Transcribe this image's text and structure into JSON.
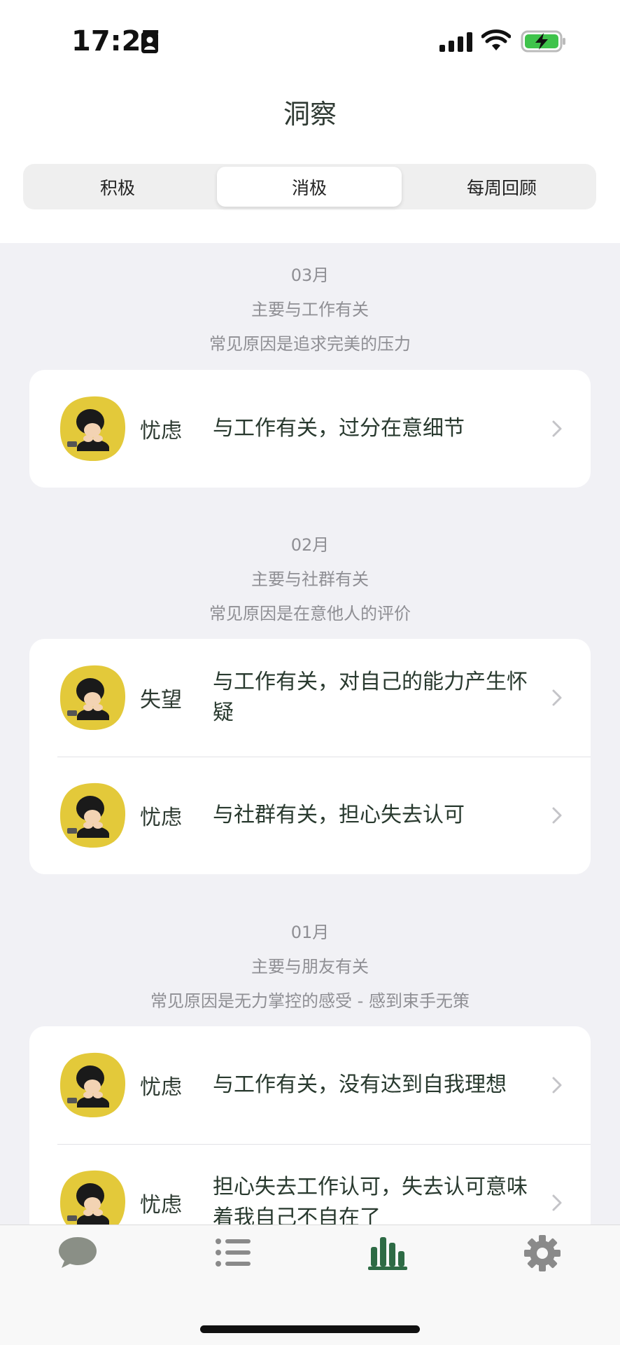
{
  "status": {
    "time": "17:27"
  },
  "header": {
    "title": "洞察"
  },
  "segments": [
    {
      "label": "积极",
      "active": false
    },
    {
      "label": "消极",
      "active": true
    },
    {
      "label": "每周回顾",
      "active": false
    }
  ],
  "months": [
    {
      "month": "03月",
      "summary": "主要与工作有关",
      "cause": "常见原因是追求完美的压力",
      "entries": [
        {
          "emotion": "忧虑",
          "reason": "与工作有关，过分在意细节"
        }
      ]
    },
    {
      "month": "02月",
      "summary": "主要与社群有关",
      "cause": "常见原因是在意他人的评价",
      "entries": [
        {
          "emotion": "失望",
          "reason": "与工作有关，对自己的能力产生怀疑"
        },
        {
          "emotion": "忧虑",
          "reason": "与社群有关，担心失去认可"
        }
      ]
    },
    {
      "month": "01月",
      "summary": "主要与朋友有关",
      "cause": "常见原因是无力掌控的感受 - 感到束手无策",
      "entries": [
        {
          "emotion": "忧虑",
          "reason": "与工作有关，没有达到自我理想"
        },
        {
          "emotion": "忧虑",
          "reason": "担心失去工作认可，失去认可意味着我自己不自在了"
        }
      ]
    }
  ],
  "tabbar": {
    "items": [
      {
        "icon": "chat-bubble-icon",
        "active": false
      },
      {
        "icon": "list-icon",
        "active": false
      },
      {
        "icon": "bar-chart-icon",
        "active": true
      },
      {
        "icon": "gear-icon",
        "active": false
      }
    ]
  },
  "colors": {
    "accent": "#2e6b45",
    "avatar_bg": "#e3c93a",
    "muted_text": "#8f8f94",
    "inactive_icon": "#8a8a8a"
  }
}
